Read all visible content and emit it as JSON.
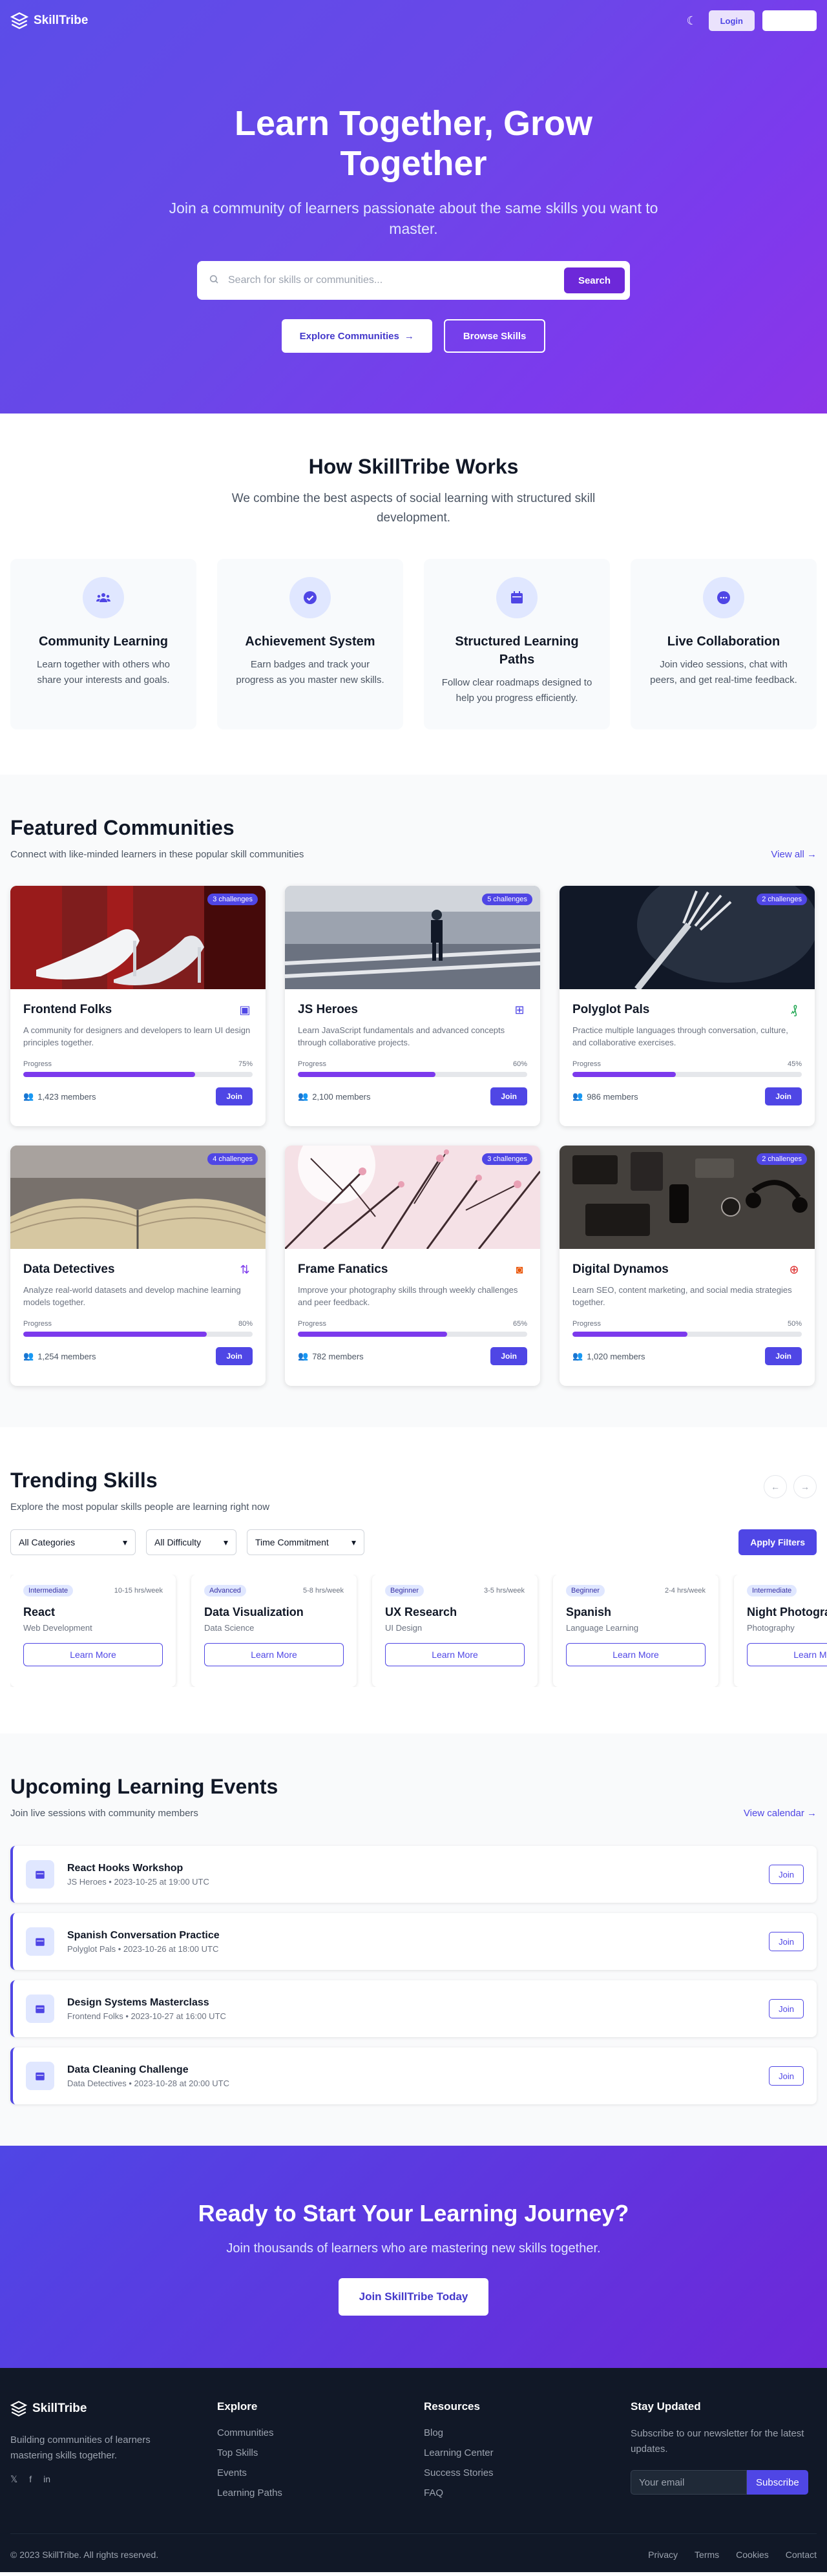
{
  "nav": {
    "brand": "SkillTribe",
    "login": "Login",
    "signup": ""
  },
  "hero": {
    "title": "Learn Together, Grow Together",
    "subtitle": "Join a community of learners passionate about the same skills you want to master.",
    "search_placeholder": "Search for skills or communities...",
    "search_button": "Search",
    "explore_button": "Explore Communities",
    "browse_button": "Browse Skills"
  },
  "how": {
    "title": "How SkillTribe Works",
    "description": "We combine the best aspects of social learning with structured skill development.",
    "features": [
      {
        "title": "Community Learning",
        "text": "Learn together with others who share your interests and goals.",
        "icon": "users-icon"
      },
      {
        "title": "Achievement System",
        "text": "Earn badges and track your progress as you master new skills.",
        "icon": "badge-check-icon"
      },
      {
        "title": "Structured Learning Paths",
        "text": "Follow clear roadmaps designed to help you progress efficiently.",
        "icon": "calendar-icon"
      },
      {
        "title": "Live Collaboration",
        "text": "Join video sessions, chat with peers, and get real-time feedback.",
        "icon": "chat-icon"
      }
    ]
  },
  "featured": {
    "title": "Featured Communities",
    "subtitle": "Connect with like-minded learners in these popular skill communities",
    "view_all": "View all",
    "progress_label": "Progress",
    "join_label": "Join",
    "communities": [
      {
        "name": "Frontend Folks",
        "desc": "A community for designers and developers to learn UI design principles together.",
        "progress": "75%",
        "progress_value": 75,
        "members": "1,423 members",
        "badge": "3 challenges",
        "icon": "layout-icon",
        "icon_color": "#4f46e5"
      },
      {
        "name": "JS Heroes",
        "desc": "Learn JavaScript fundamentals and advanced concepts through collaborative projects.",
        "progress": "60%",
        "progress_value": 60,
        "members": "2,100 members",
        "badge": "5 challenges",
        "icon": "code-icon",
        "icon_color": "#4f46e5"
      },
      {
        "name": "Polyglot Pals",
        "desc": "Practice multiple languages through conversation, culture, and collaborative exercises.",
        "progress": "45%",
        "progress_value": 45,
        "members": "986 members",
        "badge": "2 challenges",
        "icon": "translate-icon",
        "icon_color": "#16a34a"
      },
      {
        "name": "Data Detectives",
        "desc": "Analyze real-world datasets and develop machine learning models together.",
        "progress": "80%",
        "progress_value": 80,
        "members": "1,254 members",
        "badge": "4 challenges",
        "icon": "chart-icon",
        "icon_color": "#7c3aed"
      },
      {
        "name": "Frame Fanatics",
        "desc": "Improve your photography skills through weekly challenges and peer feedback.",
        "progress": "65%",
        "progress_value": 65,
        "members": "782 members",
        "badge": "3 challenges",
        "icon": "camera-icon",
        "icon_color": "#ea580c"
      },
      {
        "name": "Digital Dynamos",
        "desc": "Learn SEO, content marketing, and social media strategies together.",
        "progress": "50%",
        "progress_value": 50,
        "members": "1,020 members",
        "badge": "2 challenges",
        "icon": "target-icon",
        "icon_color": "#dc2626"
      }
    ]
  },
  "trending": {
    "title": "Trending Skills",
    "subtitle": "Explore the most popular skills people are learning right now",
    "prev": "←",
    "next": "→",
    "filters": [
      "All Categories",
      "All Difficulty",
      "Time Commitment"
    ],
    "apply": "Apply Filters",
    "learn_label": "Learn More",
    "skills": [
      {
        "level": "Intermediate",
        "hours": "10-15 hrs/week",
        "name": "React",
        "category": "Web Development"
      },
      {
        "level": "Advanced",
        "hours": "5-8 hrs/week",
        "name": "Data Visualization",
        "category": "Data Science"
      },
      {
        "level": "Beginner",
        "hours": "3-5 hrs/week",
        "name": "UX Research",
        "category": "UI Design"
      },
      {
        "level": "Beginner",
        "hours": "2-4 hrs/week",
        "name": "Spanish",
        "category": "Language Learning"
      },
      {
        "level": "Intermediate",
        "hours": "4-6",
        "name": "Night Photography",
        "category": "Photography"
      }
    ]
  },
  "events": {
    "title": "Upcoming Learning Events",
    "subtitle": "Join live sessions with community members",
    "view_calendar": "View calendar",
    "join_label": "Join",
    "items": [
      {
        "title": "React Hooks Workshop",
        "meta": "JS Heroes • 2023-10-25 at 19:00 UTC"
      },
      {
        "title": "Spanish Conversation Practice",
        "meta": "Polyglot Pals • 2023-10-26 at 18:00 UTC"
      },
      {
        "title": "Design Systems Masterclass",
        "meta": "Frontend Folks • 2023-10-27 at 16:00 UTC"
      },
      {
        "title": "Data Cleaning Challenge",
        "meta": "Data Detectives • 2023-10-28 at 20:00 UTC"
      }
    ]
  },
  "cta": {
    "title": "Ready to Start Your Learning Journey?",
    "text": "Join thousands of learners who are mastering new skills together.",
    "button": "Join SkillTribe Today"
  },
  "footer": {
    "brand": "SkillTribe",
    "about": "Building communities of learners mastering skills together.",
    "socials": [
      "𝕏",
      "f",
      "in"
    ],
    "explore": {
      "title": "Explore",
      "links": [
        "Communities",
        "Top Skills",
        "Events",
        "Learning Paths"
      ]
    },
    "resources": {
      "title": "Resources",
      "links": [
        "Blog",
        "Learning Center",
        "Success Stories",
        "FAQ"
      ]
    },
    "newsletter": {
      "title": "Stay Updated",
      "text": "Subscribe to our newsletter for the latest updates.",
      "placeholder": "Your email",
      "button": "Subscribe"
    },
    "copyright": "© 2023 SkillTribe. All rights reserved.",
    "legal": [
      "Privacy",
      "Terms",
      "Cookies",
      "Contact"
    ]
  }
}
